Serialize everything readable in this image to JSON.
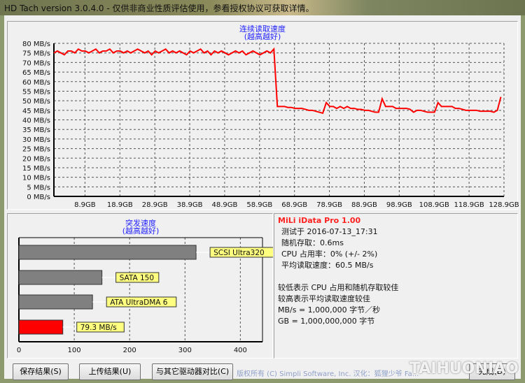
{
  "window": {
    "title": "HD Tach version 3.0.4.0  - 仅供非商业性质评估使用，参看授权协议可获取详情。"
  },
  "read_chart": {
    "title_line1": "连续读取速度",
    "title_line2": "(越高越好)",
    "chart_data": {
      "type": "line",
      "xlabel": "",
      "ylabel": "",
      "xlim": [
        0,
        128.9
      ],
      "ylim": [
        0,
        80
      ],
      "grid": true,
      "color": "#ff0000",
      "y_ticks": [
        "0 MB/s",
        "5 MB/s",
        "10 MB/s",
        "15 MB/s",
        "20 MB/s",
        "25 MB/s",
        "30 MB/s",
        "35 MB/s",
        "40 MB/s",
        "45 MB/s",
        "50 MB/s",
        "55 MB/s",
        "60 MB/s",
        "65 MB/s",
        "70 MB/s",
        "75 MB/s",
        "80 MB/s"
      ],
      "x_ticks": [
        "8.9GB",
        "18.9GB",
        "28.9GB",
        "38.9GB",
        "48.9GB",
        "58.9GB",
        "68.9GB",
        "78.9GB",
        "88.9GB",
        "98.9GB",
        "108.9GB",
        "118.9GB",
        "128.9GB"
      ],
      "x_tick_values": [
        8.9,
        18.9,
        28.9,
        38.9,
        48.9,
        58.9,
        68.9,
        78.9,
        88.9,
        98.9,
        108.9,
        118.9,
        128.9
      ],
      "y_values_per_gb": [
        75,
        76,
        75,
        74,
        76,
        76,
        75,
        77,
        76,
        76,
        75,
        76,
        77,
        75,
        76,
        76,
        77,
        75,
        76,
        76,
        75,
        76,
        75,
        76,
        77,
        76,
        75,
        76,
        74,
        76,
        75,
        76,
        77,
        75,
        76,
        75,
        76,
        75,
        74,
        76,
        75,
        76,
        77,
        75,
        76,
        74,
        76,
        75,
        76,
        75,
        74,
        75,
        76,
        75,
        76,
        74,
        75,
        76,
        75,
        74,
        75,
        76,
        75,
        77,
        47,
        47,
        47,
        46.5,
        46.5,
        46,
        46,
        46,
        45.5,
        45,
        45,
        44.5,
        44,
        43.5,
        49,
        47,
        47,
        46,
        47,
        46,
        47,
        46,
        46,
        45.5,
        45.5,
        45,
        45,
        44.5,
        44,
        44,
        51,
        47,
        47,
        47,
        46,
        46,
        46,
        46,
        45.5,
        44,
        45,
        45,
        44.5,
        44,
        44,
        44,
        49,
        47,
        47,
        47,
        47,
        46,
        46,
        45.5,
        45,
        45,
        45,
        45,
        44.5,
        44.5,
        44.5,
        44.5,
        44,
        45,
        52
      ]
    }
  },
  "burst_chart": {
    "title_line1": "突发速度",
    "title_line2": "(越高越好)",
    "chart_data": {
      "type": "bar",
      "orientation": "horizontal",
      "xlim": [
        0,
        440
      ],
      "x_ticks": [
        0,
        100,
        200,
        300,
        400
      ],
      "bars": [
        {
          "label": "SCSI Ultra320",
          "value": 320,
          "color": "#808080"
        },
        {
          "label": "SATA 150",
          "value": 150,
          "color": "#808080"
        },
        {
          "label": "ATA UltraDMA 6",
          "value": 133,
          "color": "#808080"
        },
        {
          "label": "79.3 MB/s",
          "value": 79.3,
          "color": "#ff0000"
        }
      ]
    }
  },
  "info": {
    "product": "MiLi iData Pro 1.00",
    "tested": "测试于 2016-07-13_17:31",
    "random_access": "随机存取：0.6ms",
    "cpu": "CPU 占用率：0% (+/- 2%)",
    "avg_read": "平均读取速度：60.5 MB/s",
    "note1": "较低表示 CPU 占用和随机存取较佳",
    "note2": "较高表示平均读取速度较佳",
    "note3": "MB/s = 1,000,000 字节／秒",
    "note4": "GB = 1,000,000,000 字节"
  },
  "footer": {
    "save": "保存结果(S)",
    "upload": "上传结果(U)",
    "compare": "与其它驱动器对比(C)",
    "copyright": "版权所有 (C) Simpli Software, Inc. 汉化：狐狸少爷 Fa...",
    "done": "完成(D)",
    "watermark": "TAIHUONIAO"
  }
}
